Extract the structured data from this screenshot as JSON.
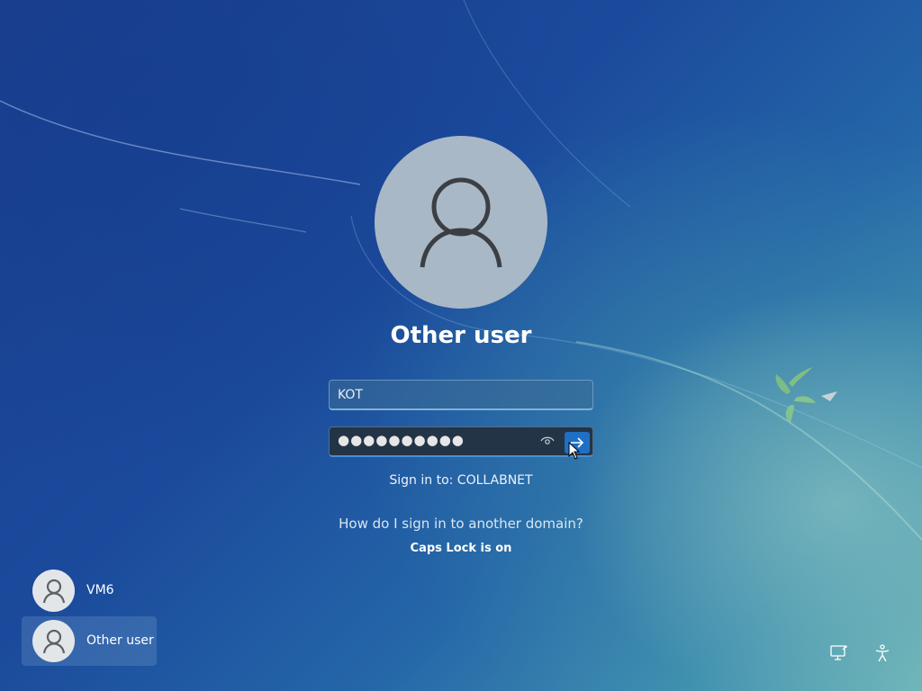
{
  "login": {
    "user_title": "Other user",
    "username_value": "KOT",
    "password_mask": "●●●●●●●●●●",
    "sign_in_to": "Sign in to: COLLABNET",
    "help_link": "How do I sign in to another domain?",
    "caps_lock_warning": "Caps Lock is on"
  },
  "user_list": [
    {
      "name": "VM6",
      "selected": false
    },
    {
      "name": "Other user",
      "selected": true
    }
  ],
  "tray": {
    "icons": [
      "network-icon",
      "accessibility-icon"
    ]
  },
  "colors": {
    "accent": "#1f6fc4",
    "avatar_bg": "#a9b8c6"
  }
}
